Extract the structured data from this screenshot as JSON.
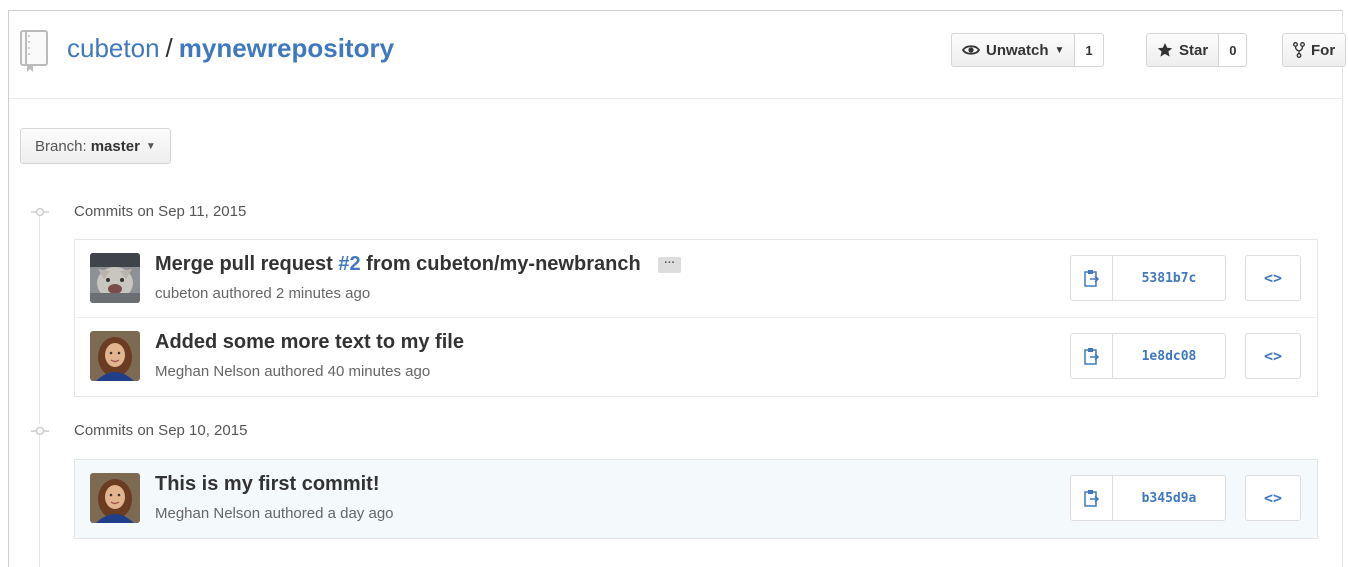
{
  "repo": {
    "owner": "cubeton",
    "separator": "/",
    "name": "mynewrepository"
  },
  "actions": {
    "watch_label": "Unwatch",
    "watch_count": "1",
    "star_label": "Star",
    "star_count": "0",
    "fork_label": "For"
  },
  "branch": {
    "prefix": "Branch:",
    "name": "master"
  },
  "groups": [
    {
      "title": "Commits on Sep 11, 2015",
      "commits": [
        {
          "msg_prefix": "Merge pull request ",
          "msg_link": "#2",
          "msg_suffix": " from cubeton/my-newbranch",
          "ellipsis": "···",
          "meta": "cubeton authored 2 minutes ago",
          "sha": "5381b7c",
          "browse": "<>"
        },
        {
          "msg": "Added some more text to my file",
          "meta": "Meghan Nelson authored 40 minutes ago",
          "sha": "1e8dc08",
          "browse": "<>"
        }
      ]
    },
    {
      "title": "Commits on Sep 10, 2015",
      "commits": [
        {
          "msg": "This is my first commit!",
          "meta": "Meghan Nelson authored a day ago",
          "sha": "b345d9a",
          "browse": "<>"
        }
      ]
    }
  ],
  "icons": {
    "repo": "repo-icon",
    "watch": "eye-icon",
    "star": "star-icon",
    "fork": "fork-icon",
    "clipboard": "clipboard-icon",
    "commit_node": "git-commit-icon"
  },
  "colors": {
    "link": "#4078c0",
    "highlight_row": "#f4f9fb"
  }
}
